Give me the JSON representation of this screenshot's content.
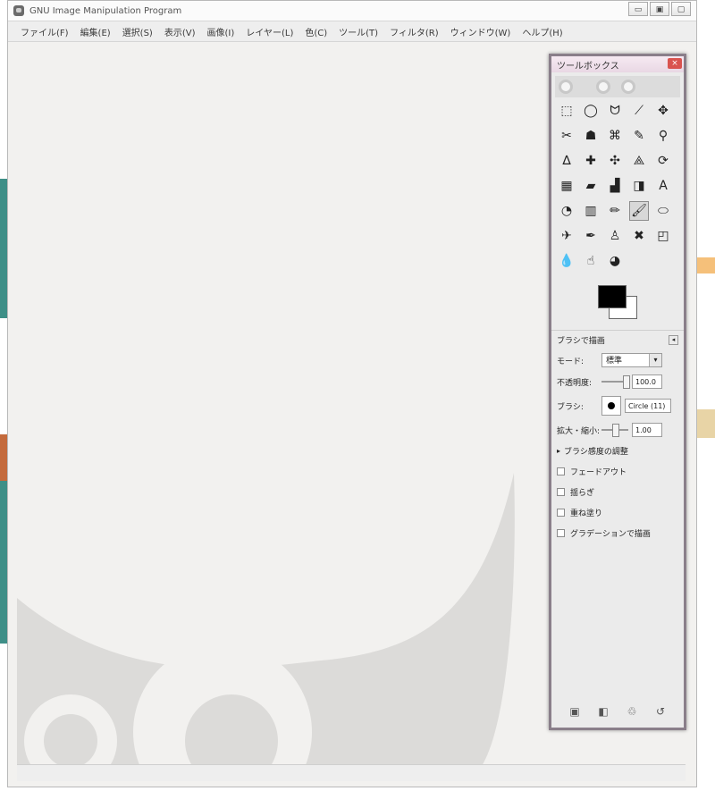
{
  "window": {
    "title": "GNU Image Manipulation Program",
    "controls": {
      "minimize": "▭",
      "maximize": "▣",
      "close": "▢"
    }
  },
  "menubar": [
    "ファイル(F)",
    "編集(E)",
    "選択(S)",
    "表示(V)",
    "画像(I)",
    "レイヤー(L)",
    "色(C)",
    "ツール(T)",
    "フィルタ(R)",
    "ウィンドウ(W)",
    "ヘルプ(H)"
  ],
  "toolbox": {
    "title": "ツールボックス",
    "close": "×",
    "tools": [
      {
        "glyph": "⬚",
        "name": "rect-select"
      },
      {
        "glyph": "◯",
        "name": "ellipse-select"
      },
      {
        "glyph": "ᗢ",
        "name": "free-select"
      },
      {
        "glyph": "⟋",
        "name": "fuzzy-select"
      },
      {
        "glyph": "✥",
        "name": "select-by-color"
      },
      {
        "glyph": "✂",
        "name": "scissors-select"
      },
      {
        "glyph": "☗",
        "name": "foreground-select"
      },
      {
        "glyph": "⌘",
        "name": "paths"
      },
      {
        "glyph": "✎",
        "name": "color-picker"
      },
      {
        "glyph": "⚲",
        "name": "zoom"
      },
      {
        "glyph": "∆",
        "name": "measure"
      },
      {
        "glyph": "✚",
        "name": "move"
      },
      {
        "glyph": "✣",
        "name": "alignment"
      },
      {
        "glyph": "⟁",
        "name": "crop"
      },
      {
        "glyph": "⟳",
        "name": "rotate"
      },
      {
        "glyph": "▦",
        "name": "scale"
      },
      {
        "glyph": "▰",
        "name": "shear"
      },
      {
        "glyph": "▟",
        "name": "perspective"
      },
      {
        "glyph": "◨",
        "name": "flip"
      },
      {
        "glyph": "A",
        "name": "text"
      },
      {
        "glyph": "◔",
        "name": "bucket-fill"
      },
      {
        "glyph": "▥",
        "name": "blend"
      },
      {
        "glyph": "✏",
        "name": "pencil"
      },
      {
        "glyph": "🖌",
        "name": "paintbrush"
      },
      {
        "glyph": "⬭",
        "name": "eraser"
      },
      {
        "glyph": "✈",
        "name": "airbrush"
      },
      {
        "glyph": "✒",
        "name": "ink"
      },
      {
        "glyph": "♙",
        "name": "clone"
      },
      {
        "glyph": "✖",
        "name": "heal"
      },
      {
        "glyph": "◰",
        "name": "perspective-clone"
      },
      {
        "glyph": "💧",
        "name": "blur"
      },
      {
        "glyph": "☝",
        "name": "smudge"
      },
      {
        "glyph": "◕",
        "name": "dodge-burn"
      }
    ],
    "active_tool": 23,
    "colors": {
      "foreground": "#000000",
      "background": "#ffffff"
    },
    "options": {
      "heading": "ブラシで描画",
      "mode_label": "モード:",
      "mode_value": "標準",
      "opacity_label": "不透明度:",
      "opacity_value": "100.0",
      "brush_label": "ブラシ:",
      "brush_value": "Circle (11)",
      "scale_label": "拡大・縮小:",
      "scale_value": "1.00",
      "checks": [
        "ブラシ感度の調整",
        "フェードアウト",
        "揺らぎ",
        "重ね塗り",
        "グラデーションで描画"
      ]
    },
    "bottom_buttons": [
      "save-icon",
      "restore-icon",
      "delete-icon",
      "reset-icon"
    ]
  }
}
